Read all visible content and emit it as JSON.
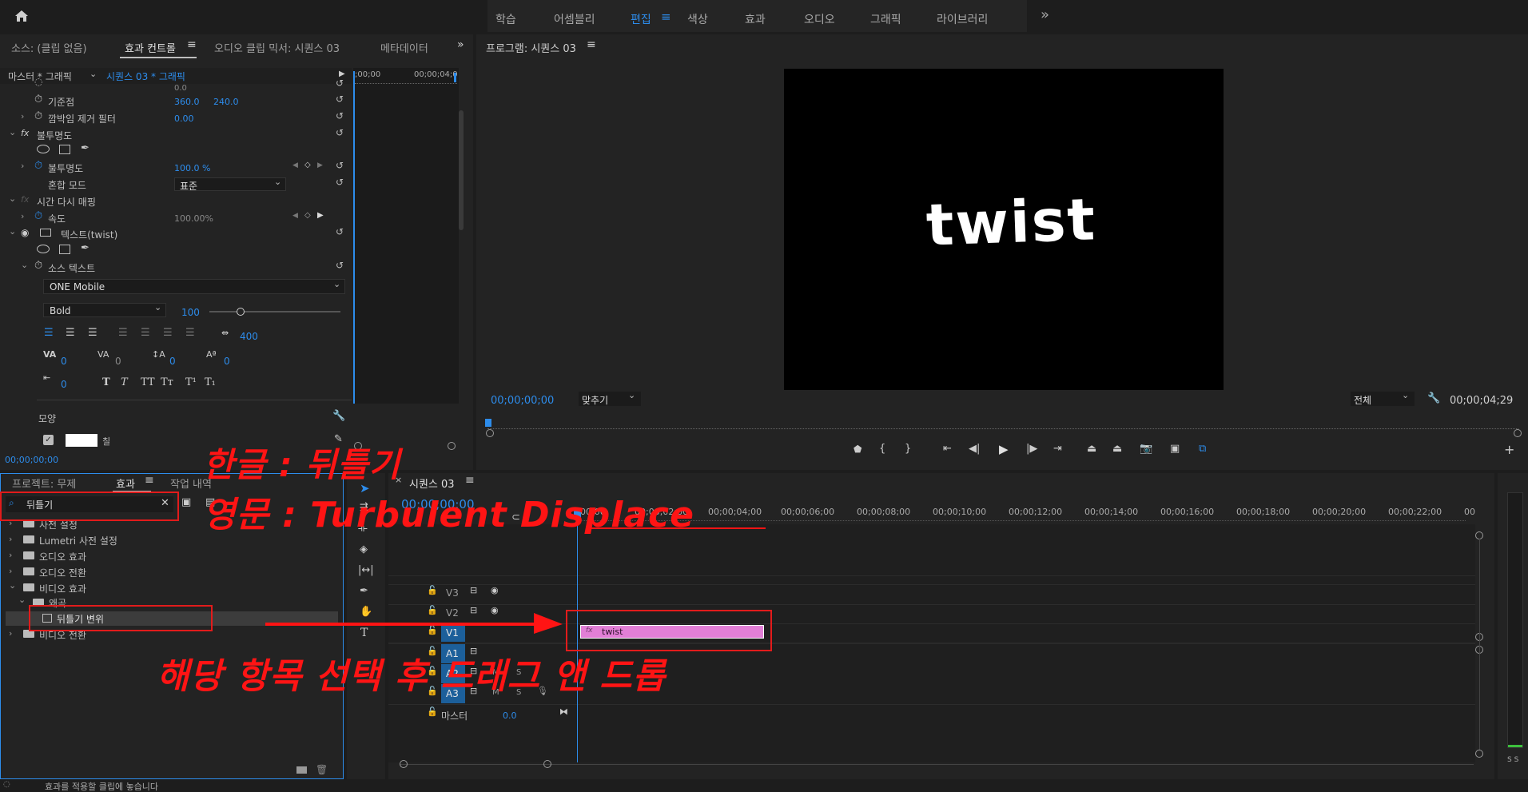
{
  "topbar": {
    "workspaces": [
      "학습",
      "어셈블리",
      "편집",
      "색상",
      "효과",
      "오디오",
      "그래픽",
      "라이브러리"
    ],
    "active_workspace": "편집",
    "more_label": "»"
  },
  "effect_controls": {
    "tabs": [
      "소스: (클립 없음)",
      "효과 컨트롤",
      "오디오 클립 믹서: 시퀀스 03",
      "메타데이터"
    ],
    "master_label": "마스터 * 그래픽",
    "sequence_label": "시퀀스 03 * 그래픽",
    "ruler_start": ";00;00",
    "ruler_end": "00;00;04;0",
    "rows": {
      "scale_partial": "0.0",
      "anchor_label": "기준점",
      "anchor_x": "360.0",
      "anchor_y": "240.0",
      "flicker_label": "깜박임 제거 필터",
      "flicker_value": "0.00",
      "opacity_group": "불투명도",
      "opacity_label": "불투명도",
      "opacity_value": "100.0 %",
      "blend_label": "혼합 모드",
      "blend_value": "표준",
      "time_remap_group": "시간 다시 매핑",
      "speed_label": "속도",
      "speed_value": "100.00%",
      "text_layer": "텍스트(twist)",
      "source_text_label": "소스 텍스트",
      "font_name": "ONE Mobile",
      "font_style": "Bold",
      "font_size": "100",
      "tracking_value": "400",
      "kerning_value": "0",
      "tracking2_value": "0",
      "leading_value": "0",
      "baseline_value": "0",
      "tsume_value": "0",
      "appearance_label": "모양",
      "fill_label": "칠"
    },
    "timecode": "00;00;00;00"
  },
  "program": {
    "title": "프로그램: 시퀀스 03",
    "preview_text": "twist",
    "timecode": "00;00;00;00",
    "fit_label": "맞추기",
    "quality_label": "전체",
    "duration": "00;00;04;29"
  },
  "effects_panel": {
    "tabs": [
      "프로젝트: 무제",
      "효과",
      "작업 내역"
    ],
    "search_value": "뒤틀기",
    "tree": [
      "사전 설정",
      "Lumetri 사전 설정",
      "오디오 효과",
      "오디오 전환",
      "비디오 효과",
      "왜곡",
      "뒤틀기 변위",
      "비디오 전환"
    ]
  },
  "timeline": {
    "tab_label": "시퀀스 03",
    "timecode": "00;00;00;00",
    "ruler": [
      "00;00",
      "00;00;02;00",
      "00;00;04;00",
      "00;00;06;00",
      "00;00;08;00",
      "00;00;10;00",
      "00;00;12;00",
      "00;00;14;00",
      "00;00;16;00",
      "00;00;18;00",
      "00;00;20;00",
      "00;00;22;00",
      "00"
    ],
    "video_tracks": [
      "V3",
      "V2",
      "V1"
    ],
    "audio_tracks": [
      "A1",
      "A2",
      "A3"
    ],
    "master_label": "마스터",
    "master_value": "0.0",
    "clip_name": "twist",
    "clip_fx": "fx",
    "mute": "M",
    "solo": "S"
  },
  "status": {
    "message": "효과를 적용할 클립에 놓습니다"
  },
  "meter": {
    "labels": "S S"
  },
  "annotations": {
    "korean": "한글 : 뒤틀기",
    "english": "영문 : Turbulent Displace",
    "instruction": "해당 항목 선택 후 드래그 앤 드롭"
  },
  "colors": {
    "accent": "#2d8ceb",
    "clip": "#e27fd6",
    "annotation": "#ff1414"
  }
}
